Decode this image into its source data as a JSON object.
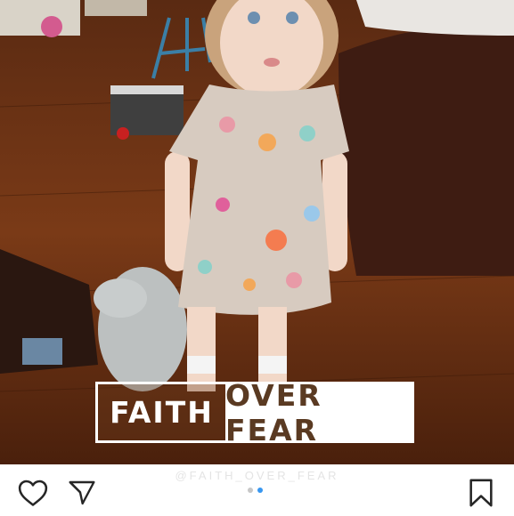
{
  "post": {
    "overlay_text": {
      "word1": "FAITH",
      "word2": "OVER FEAR"
    },
    "watermark": "@FAITH_OVER_FEAR"
  },
  "carousel": {
    "total": 2,
    "active_index": 1
  },
  "actions": {
    "like_icon": "heart-outline-icon",
    "share_icon": "paper-plane-icon",
    "save_icon": "bookmark-outline-icon"
  },
  "colors": {
    "active_dot": "#3897f0",
    "inactive_dot": "#c7c7c7",
    "icon": "#262626"
  }
}
